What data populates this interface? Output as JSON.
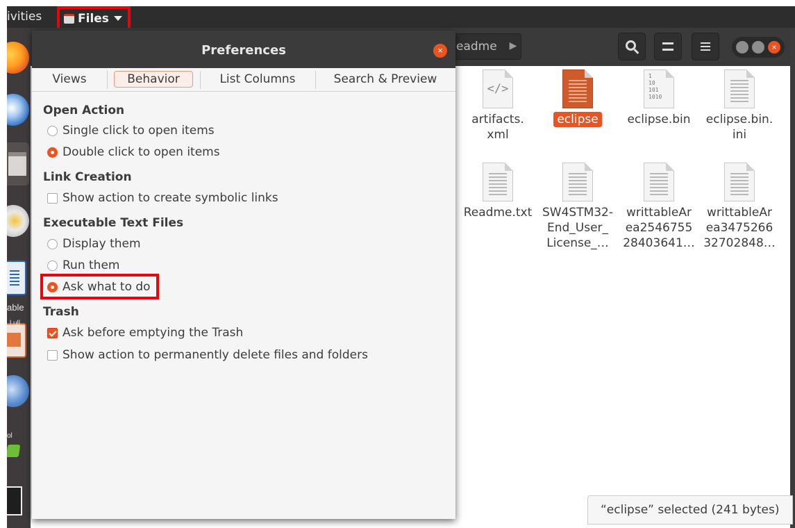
{
  "topbar": {
    "activities": "ivities",
    "files_menu": "Files"
  },
  "dock": {
    "app_text_1": "able",
    "app_text_2": "l ull",
    "app_text_3": "ol"
  },
  "file_manager": {
    "path_segment": "eadme",
    "files": [
      {
        "name": "artifacts.\nxml",
        "type": "xml"
      },
      {
        "name": "eclipse",
        "type": "executable",
        "selected": true
      },
      {
        "name": "eclipse.bin",
        "type": "binary"
      },
      {
        "name": "eclipse.bin.\nini",
        "type": "text"
      },
      {
        "name": "Readme.txt",
        "type": "text"
      },
      {
        "name": "SW4STM32-\nEnd_User_\nLicense_…",
        "type": "text"
      },
      {
        "name": "writtableAr\nea2546755\n28403641…",
        "type": "text"
      },
      {
        "name": "writtableAr\nea3475266\n32702848…",
        "type": "text"
      }
    ],
    "binary_icon_text": "1\n10\n101\n1010",
    "xml_icon_text": "</>",
    "status": "“eclipse” selected  (241 bytes)"
  },
  "preferences": {
    "title": "Preferences",
    "close_glyph": "×",
    "tabs": [
      "Views",
      "Behavior",
      "List Columns",
      "Search & Preview"
    ],
    "active_tab": "Behavior",
    "sections": {
      "open_action": {
        "heading": "Open Action",
        "options": [
          "Single click to open items",
          "Double click to open items"
        ],
        "selected": "Double click to open items"
      },
      "link_creation": {
        "heading": "Link Creation",
        "checkbox": "Show action to create symbolic links",
        "checked": false
      },
      "executable_text_files": {
        "heading": "Executable Text Files",
        "options": [
          "Display them",
          "Run them",
          "Ask what to do"
        ],
        "selected": "Ask what to do"
      },
      "trash": {
        "heading": "Trash",
        "checkboxes": [
          "Ask before emptying the Trash",
          "Show action to permanently delete files and folders"
        ],
        "checked": [
          true,
          false
        ]
      }
    }
  },
  "colors": {
    "accent": "#e95420",
    "highlight_box": "#e8060a",
    "topbar": "#2d2d2d",
    "dialog_bg": "#f5f5f5"
  }
}
